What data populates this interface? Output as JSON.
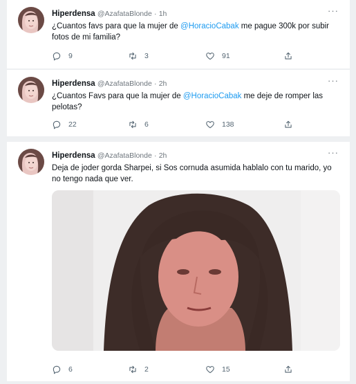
{
  "tweets": [
    {
      "name": "Hiperdensa",
      "handle": "@AzafataBlonde",
      "time": "1h",
      "text_before": "¿Cuantos favs para que la mujer de ",
      "mention": "@HoracioCabak",
      "text_after": " me pague 300k por subir fotos de mi familia?",
      "replies": "9",
      "retweets": "3",
      "likes": "91"
    },
    {
      "name": "Hiperdensa",
      "handle": "@AzafataBlonde",
      "time": "2h",
      "text_before": "¿Cuantos Favs para que la mujer de ",
      "mention": "@HoracioCabak",
      "text_after": " me deje de romper las pelotas?",
      "replies": "22",
      "retweets": "6",
      "likes": "138"
    },
    {
      "name": "Hiperdensa",
      "handle": "@AzafataBlonde",
      "time": "2h",
      "text": "Deja de joder gorda Sharpei, si Sos cornuda asumida hablalo con tu marido, yo no tengo nada que ver.",
      "replies": "6",
      "retweets": "2",
      "likes": "15"
    }
  ],
  "separator": "·",
  "more_glyph": "···",
  "icons": {
    "reply": "reply-icon",
    "retweet": "retweet-icon",
    "like": "like-icon",
    "share": "share-icon"
  },
  "colors": {
    "mention": "#1d9bf0",
    "secondary": "#6e767d",
    "background": "#eef0f2"
  }
}
